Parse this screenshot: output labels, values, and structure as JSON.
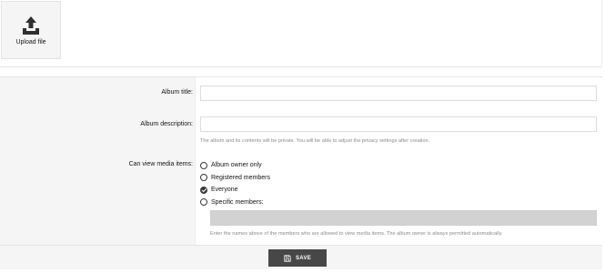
{
  "upload": {
    "label": "Upload file",
    "icon": "upload-icon"
  },
  "form": {
    "album_title": {
      "label": "Album title:",
      "value": ""
    },
    "album_description": {
      "label": "Album description:",
      "value": "",
      "hint": "The album and its contents will be private. You will be able to adjust the privacy settings after creation."
    },
    "view_media": {
      "label": "Can view media items:",
      "options": [
        {
          "label": "Album owner only",
          "selected": false
        },
        {
          "label": "Registered members",
          "selected": false
        },
        {
          "label": "Everyone",
          "selected": true
        },
        {
          "label": "Specific members:",
          "selected": false
        }
      ],
      "members_value": "",
      "hint": "Enter the names above of the members who are allowed to view media items. The album owner is always permitted automatically."
    }
  },
  "footer": {
    "save_label": "SAVE",
    "icon": "save-icon"
  },
  "colors": {
    "button_bg": "#474747",
    "panel_bg": "#f5f5f5",
    "disabled_input_bg": "#d2d2d2"
  }
}
